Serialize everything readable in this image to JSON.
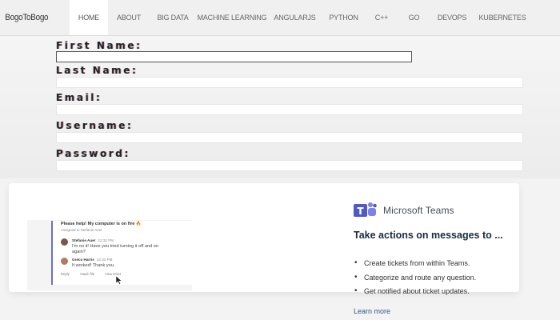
{
  "navbar": {
    "brand": "BogoToBogo",
    "items": [
      "HOME",
      "ABOUT",
      "BIG DATA",
      "MACHINE LEARNING",
      "ANGULARJS",
      "PYTHON",
      "C++",
      "GO",
      "DEVOPS",
      "KUBERNETES"
    ],
    "active_index": 0
  },
  "form": {
    "first_name_label": "First Name:",
    "last_name_label": "Last Name:",
    "email_label": "Email:",
    "username_label": "Username:",
    "password_label": "Password:"
  },
  "ad": {
    "brand": "Microsoft Teams",
    "headline": "Take actions on messages to ...",
    "bullets": [
      "Create tickets from within Teams.",
      "Categorize and route any question.",
      "Get notified about ticket updates."
    ],
    "learn_more": "Learn more",
    "preview": {
      "title": "Please help! My computer is on fire 🔥",
      "assigned": "Assigned to Stefanie Auer",
      "messages": [
        {
          "name": "Stefanie Auer",
          "time": "12:32 PM",
          "text": "I'm on it! Have you tried turning it off and on again?"
        },
        {
          "name": "Greco Harris",
          "time": "12:33 PM",
          "text": "It worked! Thank you."
        }
      ],
      "actions": [
        "Reply",
        "Attach file",
        "View ticket"
      ]
    },
    "colors": {
      "teams_purple": "#5059c9",
      "link": "#2b5797"
    }
  }
}
